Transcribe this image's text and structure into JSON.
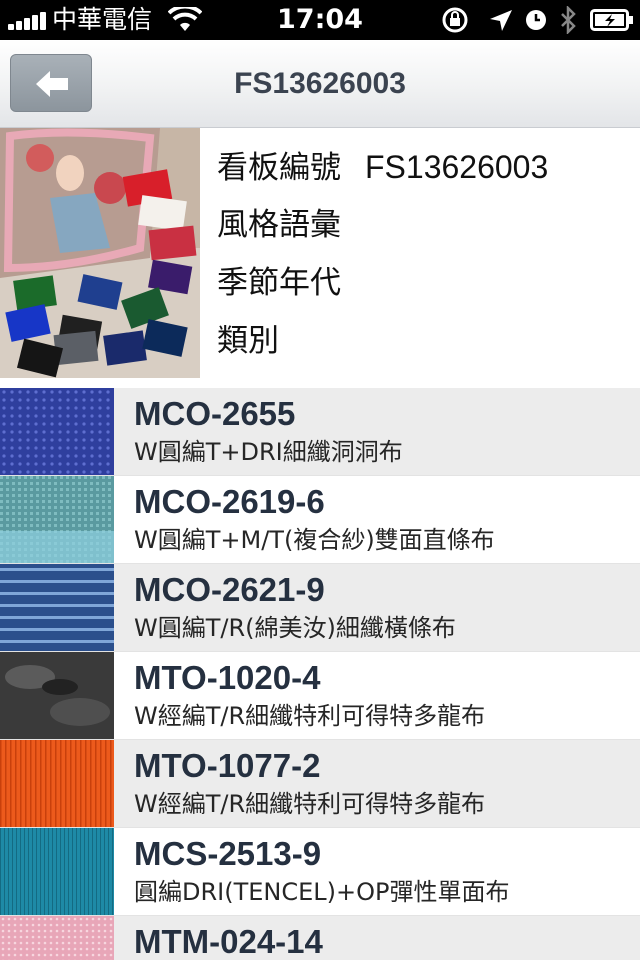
{
  "status_bar": {
    "carrier": "中華電信",
    "time": "17:04"
  },
  "nav": {
    "title": "FS13626003",
    "back_icon": "back-arrow-icon"
  },
  "detail": {
    "board_no_label": "看板編號",
    "board_no_value": "FS13626003",
    "style_label": "風格語彙",
    "season_label": "季節年代",
    "category_label": "類別"
  },
  "items": [
    {
      "code": "MCO-2655",
      "desc": "W圓編T+DRI細纖洞洞布",
      "swatch": "#2f3f9e"
    },
    {
      "code": "MCO-2619-6",
      "desc": "W圓編T+M/T(複合紗)雙面直條布",
      "swatch": "#5a9aa0"
    },
    {
      "code": "MCO-2621-9",
      "desc": "W圓編T/R(綿美汝)細纖橫條布",
      "swatch": "#2b4f8c"
    },
    {
      "code": "MTO-1020-4",
      "desc": "W經編T/R細纖特利可得特多龍布",
      "swatch": "#3a3a3a"
    },
    {
      "code": "MTO-1077-2",
      "desc": "W經編T/R細纖特利可得特多龍布",
      "swatch": "#ec5a1c"
    },
    {
      "code": "MCS-2513-9",
      "desc": "圓編DRI(TENCEL)+OP彈性單面布",
      "swatch": "#1e8aa6"
    },
    {
      "code": "MTM-024-14",
      "desc": "",
      "swatch": "#e8a6b8"
    }
  ]
}
